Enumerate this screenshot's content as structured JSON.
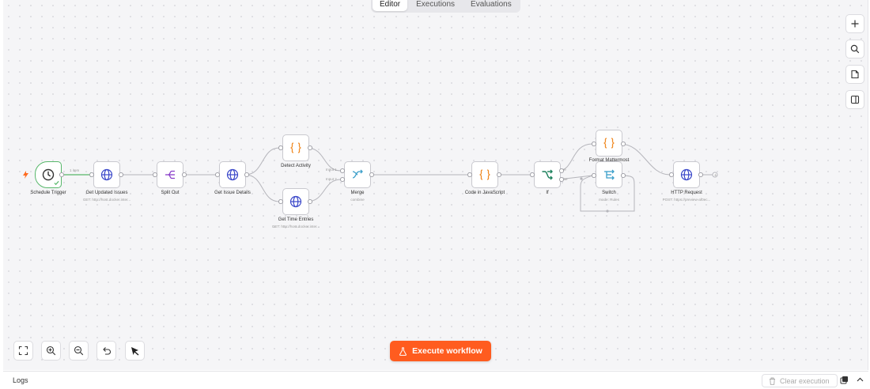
{
  "tabs": [
    {
      "label": "Editor",
      "active": true
    },
    {
      "label": "Executions",
      "active": false
    },
    {
      "label": "Evaluations",
      "active": false
    }
  ],
  "right_toolbar": [
    "plus-icon",
    "search-icon",
    "sticky-note-icon",
    "panel-toggle-icon"
  ],
  "bottom_toolbar": [
    "fit-view-icon",
    "zoom-in-icon",
    "zoom-out-icon",
    "undo-icon",
    "tidy-up-icon"
  ],
  "execute_button": {
    "label": "Execute workflow",
    "icon": "flask-icon",
    "color": "#ff5c1f"
  },
  "nodes": {
    "schedule": {
      "label": "Schedule Trigger",
      "icon": "clock-icon"
    },
    "get_updated": {
      "label": "Get Updated Issues",
      "sub": "GET: http://host.docker.inter...",
      "icon": "globe-icon"
    },
    "split": {
      "label": "Split Out",
      "icon": "split-icon"
    },
    "issue_details": {
      "label": "Get Issue Details",
      "icon": "globe-icon"
    },
    "detect": {
      "label": "Detect Activity",
      "icon": "code-braces-icon"
    },
    "time_entries": {
      "label": "Get Time Entries",
      "sub": "GET: http://host.docker.inter...",
      "icon": "globe-icon"
    },
    "merge": {
      "label": "Merge",
      "sub": "combine",
      "icon": "merge-icon"
    },
    "code_js": {
      "label": "Code in JavaScript",
      "icon": "code-braces-icon"
    },
    "if": {
      "label": "If",
      "icon": "if-icon"
    },
    "format": {
      "label": "Format Mattermost",
      "icon": "code-braces-icon"
    },
    "switch": {
      "label": "Switch",
      "sub": "mode: Rules",
      "icon": "switch-icon"
    },
    "http": {
      "label": "HTTP Request",
      "sub": "POST: https://preview-af0ec...",
      "icon": "globe-icon"
    }
  },
  "edge_labels": {
    "item_count": "1 item",
    "input1": "Input 1",
    "input2": "Input 2",
    "true": "true",
    "false": "false"
  },
  "logs": {
    "label": "Logs",
    "clear_label": "Clear execution"
  },
  "colors": {
    "success": "#57b76a",
    "accent": "#ff5c1f",
    "globe": "#3a47c9",
    "code": "#f08a24",
    "merge": "#3a9ec9"
  }
}
